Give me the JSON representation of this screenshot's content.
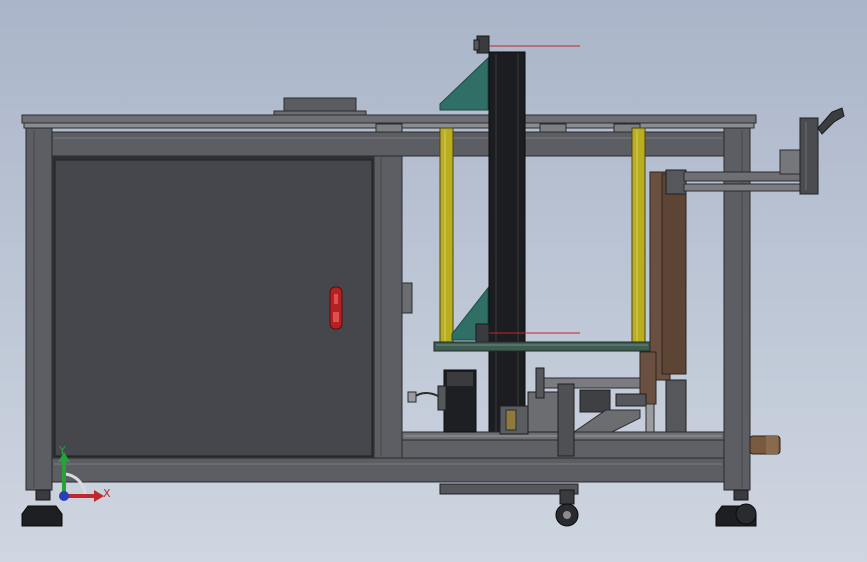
{
  "viewport": {
    "background_top": "#aab5c9",
    "background_bottom": "#cfd6e1"
  },
  "colors": {
    "frame": "#5c5e63",
    "frame_dark": "#3d3f44",
    "panel": "#45474c",
    "column": "#1c1d20",
    "gusset": "#2f6f66",
    "guide_rod": "#b9ad22",
    "wood_plate": "#6a5040",
    "handle_red": "#b52020",
    "reference_line": "#c8242a",
    "axis_x": "#c0282a",
    "axis_y": "#25a23a",
    "axis_z": "#2a3fb8"
  },
  "triad": {
    "x_label": "X",
    "y_label": "Y"
  }
}
